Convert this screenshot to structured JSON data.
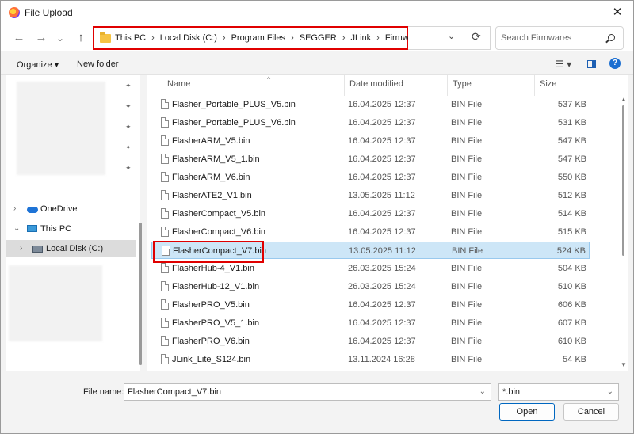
{
  "window": {
    "title": "File Upload",
    "close": "✕"
  },
  "nav": {
    "back": "←",
    "forward": "→",
    "history": "⌄",
    "up": "↑"
  },
  "address": {
    "crumbs": [
      "This PC",
      "Local Disk (C:)",
      "Program Files",
      "SEGGER",
      "JLink",
      "Firmwares"
    ],
    "separator": "›",
    "dropdown": "⌄",
    "refresh": "⟳"
  },
  "search": {
    "placeholder": "Search Firmwares"
  },
  "toolbar": {
    "organize": "Organize ▾",
    "new_folder": "New folder",
    "view": "☰ ▾",
    "help": "?"
  },
  "sidebar": {
    "pins": [
      "✦",
      "✦",
      "✦",
      "✦",
      "✦"
    ],
    "items": [
      {
        "chevron": "›",
        "label": "OneDrive"
      },
      {
        "chevron": "⌄",
        "label": "This PC"
      },
      {
        "chevron": "›",
        "label": "Local Disk (C:)"
      }
    ]
  },
  "columns": {
    "name": "Name",
    "date": "Date modified",
    "type": "Type",
    "size": "Size",
    "sort_caret": "^"
  },
  "files": [
    {
      "name": "Flasher_Portable_PLUS_V5.bin",
      "date": "16.04.2025 12:37",
      "type": "BIN File",
      "size": "537 KB"
    },
    {
      "name": "Flasher_Portable_PLUS_V6.bin",
      "date": "16.04.2025 12:37",
      "type": "BIN File",
      "size": "531 KB"
    },
    {
      "name": "FlasherARM_V5.bin",
      "date": "16.04.2025 12:37",
      "type": "BIN File",
      "size": "547 KB"
    },
    {
      "name": "FlasherARM_V5_1.bin",
      "date": "16.04.2025 12:37",
      "type": "BIN File",
      "size": "547 KB"
    },
    {
      "name": "FlasherARM_V6.bin",
      "date": "16.04.2025 12:37",
      "type": "BIN File",
      "size": "550 KB"
    },
    {
      "name": "FlasherATE2_V1.bin",
      "date": "13.05.2025 11:12",
      "type": "BIN File",
      "size": "512 KB"
    },
    {
      "name": "FlasherCompact_V5.bin",
      "date": "16.04.2025 12:37",
      "type": "BIN File",
      "size": "514 KB"
    },
    {
      "name": "FlasherCompact_V6.bin",
      "date": "16.04.2025 12:37",
      "type": "BIN File",
      "size": "515 KB"
    },
    {
      "name": "FlasherCompact_V7.bin",
      "date": "13.05.2025 11:12",
      "type": "BIN File",
      "size": "524 KB",
      "selected": true
    },
    {
      "name": "FlasherHub-4_V1.bin",
      "date": "26.03.2025 15:24",
      "type": "BIN File",
      "size": "504 KB"
    },
    {
      "name": "FlasherHub-12_V1.bin",
      "date": "26.03.2025 15:24",
      "type": "BIN File",
      "size": "510 KB"
    },
    {
      "name": "FlasherPRO_V5.bin",
      "date": "16.04.2025 12:37",
      "type": "BIN File",
      "size": "606 KB"
    },
    {
      "name": "FlasherPRO_V5_1.bin",
      "date": "16.04.2025 12:37",
      "type": "BIN File",
      "size": "607 KB"
    },
    {
      "name": "FlasherPRO_V6.bin",
      "date": "16.04.2025 12:37",
      "type": "BIN File",
      "size": "610 KB"
    },
    {
      "name": "JLink_Lite_S124.bin",
      "date": "13.11.2024 16:28",
      "type": "BIN File",
      "size": "54 KB"
    }
  ],
  "bottom": {
    "file_name_label": "File name:",
    "file_name_value": "FlasherCompact_V7.bin",
    "filter_value": "*.bin",
    "dropdown": "⌄",
    "open": "Open",
    "cancel": "Cancel"
  },
  "colors": {
    "highlight": "#e00000",
    "selection": "#cde6f7",
    "accent": "#0067c0"
  }
}
